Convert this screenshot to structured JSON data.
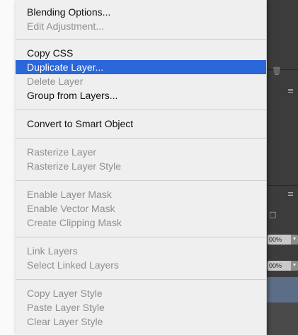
{
  "context_menu": {
    "items": [
      {
        "label": "Blending Options...",
        "enabled": true
      },
      {
        "label": "Edit Adjustment...",
        "enabled": false
      },
      {
        "label": "Copy CSS",
        "enabled": true
      },
      {
        "label": "Duplicate Layer...",
        "enabled": true,
        "highlighted": true
      },
      {
        "label": "Delete Layer",
        "enabled": false
      },
      {
        "label": "Group from Layers...",
        "enabled": true
      },
      {
        "label": "Convert to Smart Object",
        "enabled": true
      },
      {
        "label": "Rasterize Layer",
        "enabled": false
      },
      {
        "label": "Rasterize Layer Style",
        "enabled": false
      },
      {
        "label": "Enable Layer Mask",
        "enabled": false
      },
      {
        "label": "Enable Vector Mask",
        "enabled": false
      },
      {
        "label": "Create Clipping Mask",
        "enabled": false
      },
      {
        "label": "Link Layers",
        "enabled": false
      },
      {
        "label": "Select Linked Layers",
        "enabled": false
      },
      {
        "label": "Copy Layer Style",
        "enabled": false
      },
      {
        "label": "Paste Layer Style",
        "enabled": false
      },
      {
        "label": "Clear Layer Style",
        "enabled": false
      }
    ]
  },
  "background_panel": {
    "opacity_value": "00%",
    "fill_value": "00%"
  },
  "colors": {
    "menu_bg": "#efefef",
    "highlight": "#2a67d8",
    "disabled_text": "#8f8f8f",
    "panel_dark": "#3c3c3c",
    "selected_layer": "#5c6d88"
  }
}
